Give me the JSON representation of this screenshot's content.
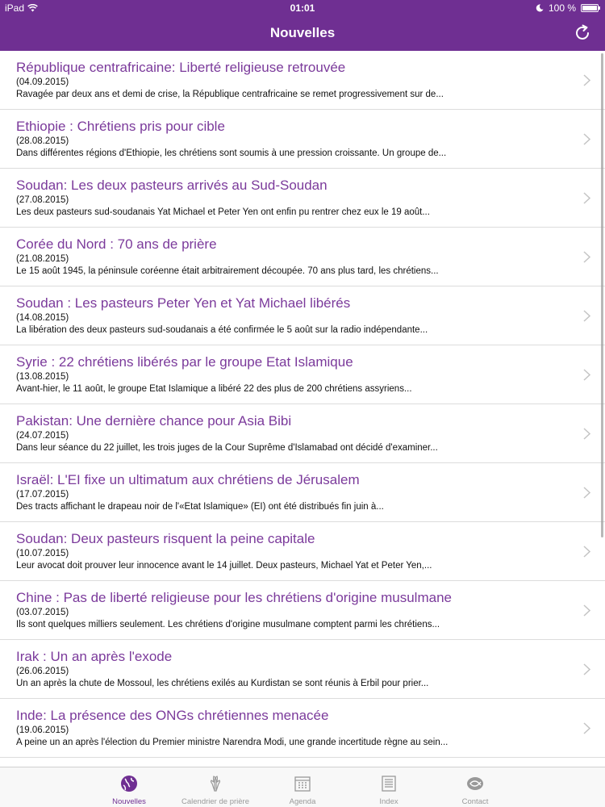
{
  "status": {
    "device": "iPad",
    "time": "01:01",
    "battery": "100 %",
    "battery_level": 1.0
  },
  "header": {
    "title": "Nouvelles",
    "refresh_icon": "refresh-icon"
  },
  "colors": {
    "brand": "#6f2f92",
    "title_text": "#7b3a9b"
  },
  "news": [
    {
      "title": "République centrafricaine: Liberté religieuse retrouvée",
      "date": "(04.09.2015)",
      "summary": "Ravagée par deux ans et demi de crise, la République centrafricaine se remet progressivement sur de..."
    },
    {
      "title": "Ethiopie : Chrétiens pris pour cible",
      "date": "(28.08.2015)",
      "summary": "Dans différentes régions d'Ethiopie, les chrétiens sont soumis à une pression croissante. Un groupe de..."
    },
    {
      "title": "Soudan: Les deux pasteurs arrivés au Sud-Soudan",
      "date": "(27.08.2015)",
      "summary": "Les deux pasteurs sud-soudanais Yat Michael et Peter Yen ont enfin pu rentrer chez eux le 19 août..."
    },
    {
      "title": "Corée du Nord : 70 ans de prière",
      "date": "(21.08.2015)",
      "summary": "Le 15 août 1945, la péninsule coréenne était arbitrairement découpée. 70 ans plus tard, les chrétiens..."
    },
    {
      "title": "Soudan : Les pasteurs Peter Yen et Yat Michael libérés",
      "date": "(14.08.2015)",
      "summary": "La libération des deux pasteurs sud-soudanais a été confirmée le 5 août sur la radio indépendante..."
    },
    {
      "title": "Syrie : 22 chrétiens libérés par le groupe Etat Islamique",
      "date": "(13.08.2015)",
      "summary": "Avant-hier, le 11 août, le groupe Etat Islamique a libéré 22 des plus de 200 chrétiens assyriens..."
    },
    {
      "title": "Pakistan: Une dernière chance pour Asia Bibi",
      "date": "(24.07.2015)",
      "summary": "Dans leur séance du 22 juillet, les trois juges de la Cour Suprême d'Islamabad ont décidé d'examiner..."
    },
    {
      "title": "Israël: L'EI fixe un ultimatum aux chrétiens de Jérusalem",
      "date": "(17.07.2015)",
      "summary": "Des tracts affichant le drapeau noir de l'«Etat Islamique» (EI) ont été distribués fin juin à..."
    },
    {
      "title": "Soudan: Deux pasteurs risquent la peine capitale",
      "date": "(10.07.2015)",
      "summary": "Leur avocat doit prouver leur innocence avant le 14 juillet. Deux pasteurs, Michael Yat et Peter Yen,..."
    },
    {
      "title": "Chine : Pas de liberté religieuse pour les chrétiens d'origine musulmane",
      "date": "(03.07.2015)",
      "summary": "Ils sont quelques milliers seulement. Les chrétiens d'origine musulmane comptent parmi les chrétiens..."
    },
    {
      "title": "Irak : Un an après l'exode",
      "date": "(26.06.2015)",
      "summary": "Un an après la chute de Mossoul, les chrétiens exilés au Kurdistan se sont réunis à Erbil pour prier..."
    },
    {
      "title": "Inde: La présence des ONGs chrétiennes menacée",
      "date": "(19.06.2015)",
      "summary": "A peine un an après l'élection du Premier ministre Narendra Modi, une grande incertitude règne au sein..."
    }
  ],
  "tabs": [
    {
      "label": "Nouvelles",
      "icon": "globe-icon",
      "active": true
    },
    {
      "label": "Calendrier de prière",
      "icon": "praying-hands-icon",
      "active": false
    },
    {
      "label": "Agenda",
      "icon": "calendar-icon",
      "active": false
    },
    {
      "label": "Index",
      "icon": "list-icon",
      "active": false
    },
    {
      "label": "Contact",
      "icon": "fish-icon",
      "active": false
    }
  ]
}
